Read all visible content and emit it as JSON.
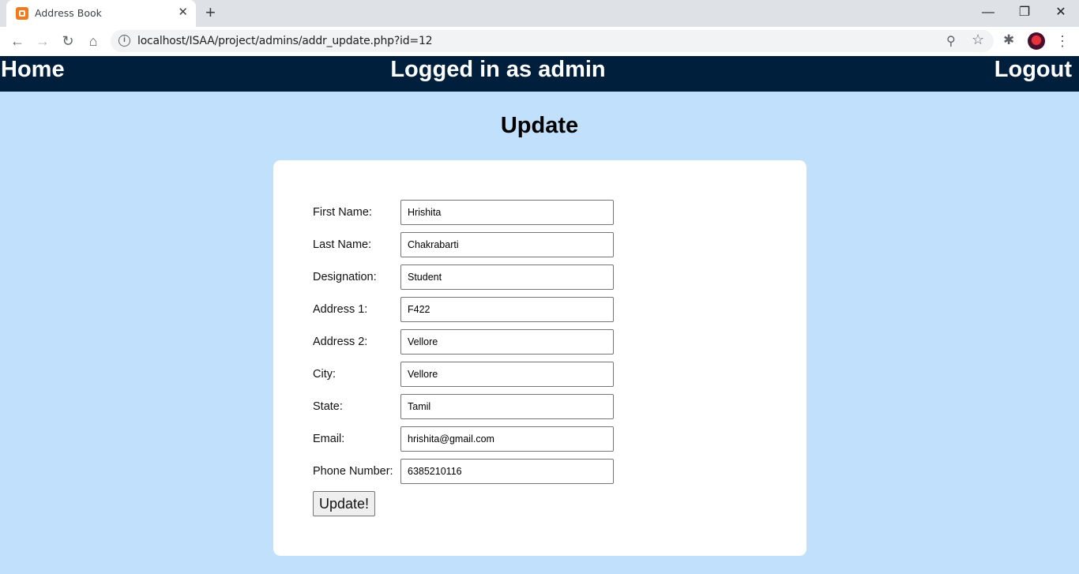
{
  "browser": {
    "tab_title": "Address Book",
    "url": "localhost/ISAA/project/admins/addr_update.php?id=12"
  },
  "nav": {
    "home": "Home",
    "user_status": "Logged in as admin",
    "logout": "Logout"
  },
  "page": {
    "title": "Update"
  },
  "form": {
    "fields": [
      {
        "label": "First Name:",
        "value": "Hrishita"
      },
      {
        "label": "Last Name:",
        "value": "Chakrabarti"
      },
      {
        "label": "Designation:",
        "value": "Student"
      },
      {
        "label": "Address 1:",
        "value": "F422"
      },
      {
        "label": "Address 2:",
        "value": "Vellore"
      },
      {
        "label": "City:",
        "value": "Vellore"
      },
      {
        "label": "State:",
        "value": "Tamil"
      },
      {
        "label": "Email:",
        "value": "hrishita@gmail.com"
      },
      {
        "label": "Phone Number:",
        "value": "6385210116"
      }
    ],
    "submit_label": "Update!"
  },
  "colors": {
    "page_background": "#c0e0fb",
    "nav_background": "#001f3d",
    "card_background": "#ffffff"
  }
}
